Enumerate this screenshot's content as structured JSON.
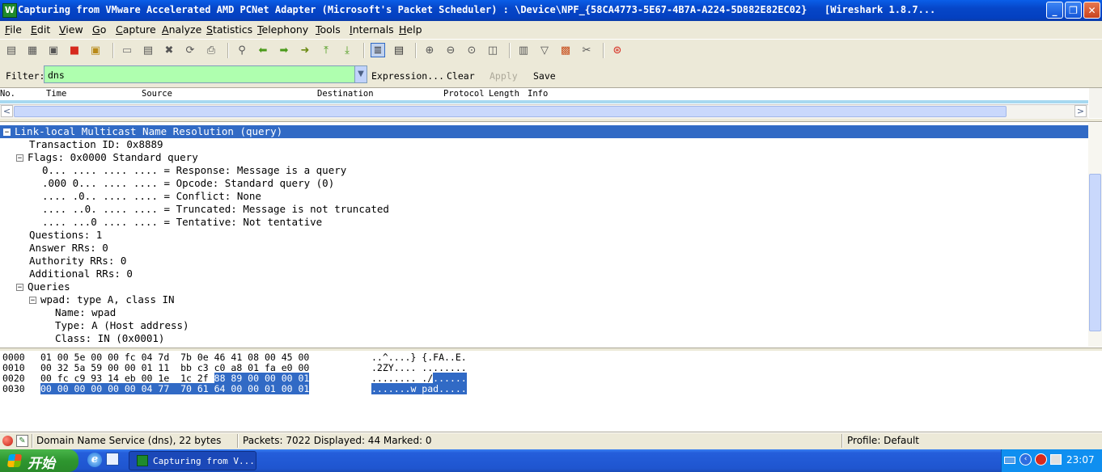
{
  "window": {
    "title": "Capturing from VMware Accelerated AMD PCNet Adapter (Microsoft's Packet Scheduler) : \\Device\\NPF_{58CA4773-5E67-4B7A-A224-5D882E82EC02}   [Wireshark 1.8.7...",
    "app_icon_glyph": "W",
    "minimize": "_",
    "restore": "❐",
    "close": "✕"
  },
  "menu": [
    {
      "key": "file",
      "label": "File"
    },
    {
      "key": "edit",
      "label": "Edit"
    },
    {
      "key": "view",
      "label": "View"
    },
    {
      "key": "go",
      "label": "Go"
    },
    {
      "key": "capture",
      "label": "Capture"
    },
    {
      "key": "analyze",
      "label": "Analyze"
    },
    {
      "key": "statistics",
      "label": "Statistics"
    },
    {
      "key": "telephony",
      "label": "Telephony"
    },
    {
      "key": "tools",
      "label": "Tools"
    },
    {
      "key": "internals",
      "label": "Internals"
    },
    {
      "key": "help",
      "label": "Help"
    }
  ],
  "toolbar": [
    {
      "name": "interfaces-icon",
      "glyph": "▤",
      "color": "#555555"
    },
    {
      "name": "options-icon",
      "glyph": "▦",
      "color": "#555555"
    },
    {
      "name": "start-capture-icon",
      "glyph": "▣",
      "color": "#555555"
    },
    {
      "name": "stop-capture-icon",
      "glyph": "■",
      "color": "#d62a1e"
    },
    {
      "name": "restart-capture-icon",
      "glyph": "▣",
      "color": "#b88a18"
    },
    {
      "name": "open-file-icon",
      "glyph": "▭",
      "color": "#777777"
    },
    {
      "name": "save-file-icon",
      "glyph": "▤",
      "color": "#555555"
    },
    {
      "name": "close-file-icon",
      "glyph": "✖",
      "color": "#555555"
    },
    {
      "name": "reload-icon",
      "glyph": "⟳",
      "color": "#555555"
    },
    {
      "name": "print-icon",
      "glyph": "⎙",
      "color": "#555555"
    },
    {
      "name": "find-packet-icon",
      "glyph": "⚲",
      "color": "#555555"
    },
    {
      "name": "go-back-icon",
      "glyph": "⬅",
      "color": "#4a9a1a"
    },
    {
      "name": "go-forward-icon",
      "glyph": "➡",
      "color": "#4a9a1a"
    },
    {
      "name": "go-to-packet-icon",
      "glyph": "➜",
      "color": "#6a8a12"
    },
    {
      "name": "first-packet-icon",
      "glyph": "⤒",
      "color": "#4a9a1a"
    },
    {
      "name": "last-packet-icon",
      "glyph": "⤓",
      "color": "#4a9a1a"
    },
    {
      "name": "colorize-icon",
      "glyph": "≣",
      "color": "#333333"
    },
    {
      "name": "autoscroll-icon",
      "glyph": "▤",
      "color": "#333333"
    },
    {
      "name": "zoom-in-icon",
      "glyph": "⊕",
      "color": "#555555"
    },
    {
      "name": "zoom-out-icon",
      "glyph": "⊖",
      "color": "#555555"
    },
    {
      "name": "zoom-normal-icon",
      "glyph": "⊙",
      "color": "#555555"
    },
    {
      "name": "resize-columns-icon",
      "glyph": "◫",
      "color": "#555555"
    },
    {
      "name": "capture-filters-icon",
      "glyph": "▥",
      "color": "#555555"
    },
    {
      "name": "display-filters-icon",
      "glyph": "▽",
      "color": "#555555"
    },
    {
      "name": "coloring-rules-icon",
      "glyph": "▩",
      "color": "#c8501e"
    },
    {
      "name": "preferences-icon",
      "glyph": "✂",
      "color": "#555555"
    },
    {
      "name": "help-icon",
      "glyph": "⊛",
      "color": "#d62a1e"
    }
  ],
  "filter": {
    "label": "Filter:",
    "value": "dns",
    "dropdown_glyph": "▼",
    "expression": "Expression...",
    "clear": "Clear",
    "apply": "Apply",
    "save": "Save"
  },
  "packet_list": {
    "columns": [
      "No.",
      "Time",
      "Source",
      "Destination",
      "Protocol",
      "Length",
      "Info"
    ]
  },
  "details": [
    {
      "text": "Link-local Multicast Name Resolution (query)",
      "expander": "−",
      "selected": true
    },
    {
      "text": "Transaction ID: 0x8889",
      "expander": ""
    },
    {
      "text": "Flags: 0x0000 Standard query",
      "expander": "−"
    },
    {
      "text": "0... .... .... .... = Response: Message is a query",
      "expander": ""
    },
    {
      "text": ".000 0... .... .... = Opcode: Standard query (0)",
      "expander": ""
    },
    {
      "text": ".... .0.. .... .... = Conflict: None",
      "expander": ""
    },
    {
      "text": ".... ..0. .... .... = Truncated: Message is not truncated",
      "expander": ""
    },
    {
      "text": ".... ...0 .... .... = Tentative: Not tentative",
      "expander": ""
    },
    {
      "text": "Questions: 1",
      "expander": ""
    },
    {
      "text": "Answer RRs: 0",
      "expander": ""
    },
    {
      "text": "Authority RRs: 0",
      "expander": ""
    },
    {
      "text": "Additional RRs: 0",
      "expander": ""
    },
    {
      "text": "Queries",
      "expander": "−"
    },
    {
      "text": "wpad: type A, class IN",
      "expander": "−"
    },
    {
      "text": "Name: wpad",
      "expander": ""
    },
    {
      "text": "Type: A (Host address)",
      "expander": ""
    },
    {
      "text": "Class: IN (0x0001)",
      "expander": ""
    }
  ],
  "bytes": [
    {
      "offset": "0000",
      "hex_plain": "01 00 5e 00 00 fc 04 7d  7b 0e 46 41 08 00 45 00",
      "hex_hl": "",
      "ascii_plain": "..^....} {.FA..E.",
      "ascii_hl": ""
    },
    {
      "offset": "0010",
      "hex_plain": "00 32 5a 59 00 00 01 11  bb c3 c0 a8 01 fa e0 00",
      "hex_hl": "",
      "ascii_plain": ".2ZY.... ........",
      "ascii_hl": ""
    },
    {
      "offset": "0020",
      "hex_plain": "00 fc c9 93 14 eb 00 1e  1c 2f ",
      "hex_hl": "88 89 00 00 00 01",
      "ascii_plain": "........ ./",
      "ascii_hl": "......"
    },
    {
      "offset": "0030",
      "hex_plain": "",
      "hex_hl": "00 00 00 00 00 00 04 77  70 61 64 00 00 01 00 01",
      "ascii_plain": "",
      "ascii_hl": ".......w pad....."
    }
  ],
  "status": {
    "field": "Domain Name Service (dns), 22 bytes",
    "packets": "Packets: 7022 Displayed: 44 Marked: 0",
    "profile": "Profile: Default"
  },
  "taskbar": {
    "start": "开始",
    "task": "Capturing from V...",
    "clock": "23:07"
  },
  "colors": {
    "selection": "#316ac5",
    "filter_valid": "#afffaf",
    "titlebar": "#0a5ee8"
  }
}
